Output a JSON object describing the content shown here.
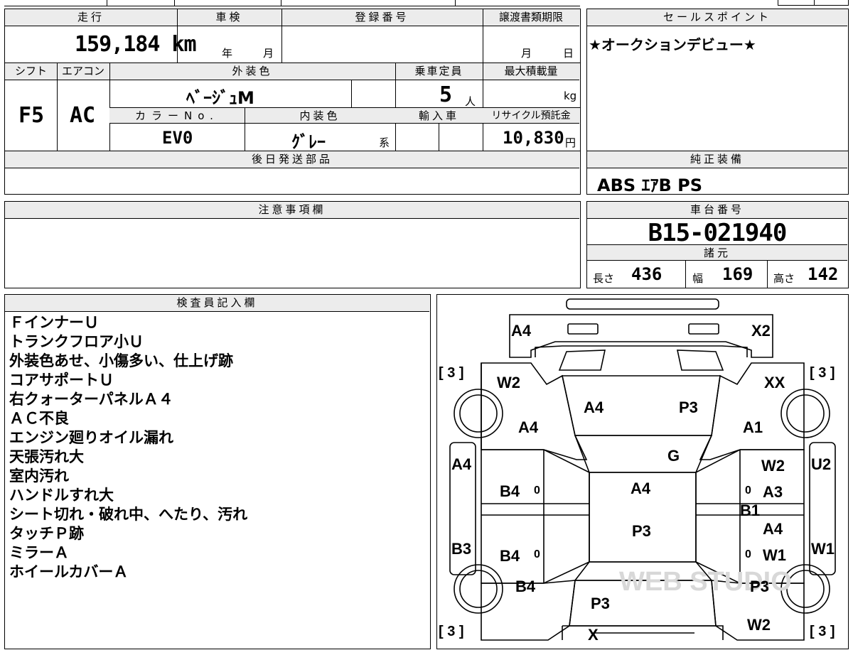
{
  "top_left": {
    "mileage_label": "走行",
    "mileage_value": "159,184 km",
    "shaken_label": "車検",
    "shaken_year_unit": "年",
    "shaken_month_unit": "月",
    "registration_label": "登録番号",
    "transfer_deadline_label": "譲渡書類期限",
    "transfer_month_unit": "月",
    "transfer_day_unit": "日",
    "shift_label": "シフト",
    "shift_value": "F5",
    "aircon_label": "エアコン",
    "aircon_value": "AC",
    "exterior_color_label": "外装色",
    "exterior_color_value": "ﾍﾞｰｼﾞｭM",
    "capacity_label": "乗車定員",
    "capacity_value": "5",
    "capacity_unit": "人",
    "max_load_label": "最大積載量",
    "max_load_unit": "kg",
    "color_no_label": "カラーNo.",
    "color_no_value": "EV0",
    "interior_color_label": "内装色",
    "interior_color_value": "ｸﾞﾚｰ",
    "interior_color_suffix": "系",
    "import_label": "輸入車",
    "recycle_label": "リサイクル預託金",
    "recycle_value": "10,830",
    "recycle_unit": "円",
    "later_parts_label": "後日発送部品"
  },
  "sales_point": {
    "label": "セールスポイント",
    "text": "★オークションデビュー★"
  },
  "standard_equipment": {
    "label": "純正装備",
    "value": "ABS ｴｱB PS"
  },
  "caution": {
    "label": "注意事項欄"
  },
  "chassis": {
    "label": "車台番号",
    "value": "B15-021940"
  },
  "specs": {
    "label": "諸元",
    "length_label": "長さ",
    "length_value": "436",
    "width_label": "幅",
    "width_value": "169",
    "height_label": "高さ",
    "height_value": "142"
  },
  "inspector": {
    "label": "検査員記入欄",
    "lines": [
      "ＦインナーＵ",
      "トランクフロア小Ｕ",
      "外装色あせ、小傷多い、仕上げ跡",
      "コアサポートＵ",
      "右クォーターパネルＡ４",
      "ＡＣ不良",
      "エンジン廻りオイル漏れ",
      "天張汚れ大",
      "室内汚れ",
      "ハンドルすれ大",
      "シート切れ・破れ中、へたり、汚れ",
      "タッチＰ跡",
      "ミラーＡ",
      "ホイールカバーＡ"
    ]
  },
  "diagram": {
    "marks": {
      "front_left": "A4",
      "front_right": "X2",
      "hood_left": "A4",
      "hood_right": "P3",
      "fender_left_upper": "W2",
      "fender_left": "A4",
      "fender_right_upper": "XX",
      "fender_right": "A1",
      "windshield": "G",
      "roof": "A4",
      "roof_lower": "P3",
      "side_left": "A4",
      "side_right": "U2",
      "door_left_front": "B4",
      "door_left_rear": "B4",
      "door_right_front": "W2",
      "door_right_front2": "A3",
      "pillar_right": "B1",
      "door_right_rear": "A4",
      "door_right_rear2": "W1",
      "side_left_lower": "B3",
      "side_right_lower": "W1",
      "quarter_left": "B4",
      "quarter_right": "P3",
      "trunk": "P3",
      "rear_right": "W2",
      "rear_center": "X",
      "tire_fl": "[ 3 ]",
      "tire_fr": "[ 3 ]",
      "tire_rl": "[ 3 ]",
      "tire_rr": "[ 3 ]",
      "zero1": "0",
      "zero2": "0",
      "zero3": "0",
      "zero4": "0"
    },
    "watermark": "WEB STUDIO"
  }
}
